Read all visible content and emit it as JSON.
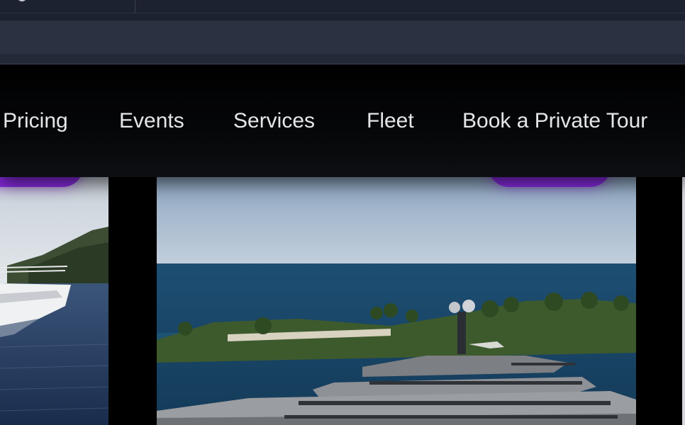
{
  "nav": {
    "items": [
      {
        "label": "Pricing"
      },
      {
        "label": "Events"
      },
      {
        "label": "Services"
      },
      {
        "label": "Fleet"
      },
      {
        "label": "Book a Private Tour"
      }
    ]
  },
  "colors": {
    "accent": "#8a2be2",
    "nav_text": "#e4e6ea",
    "chrome_bg": "#1d2230",
    "urlbar_bg": "#2c3142"
  },
  "images": {
    "left_slide": "yacht-on-sea-with-hillside",
    "center_slide": "gray-superyacht-near-palm-island"
  }
}
